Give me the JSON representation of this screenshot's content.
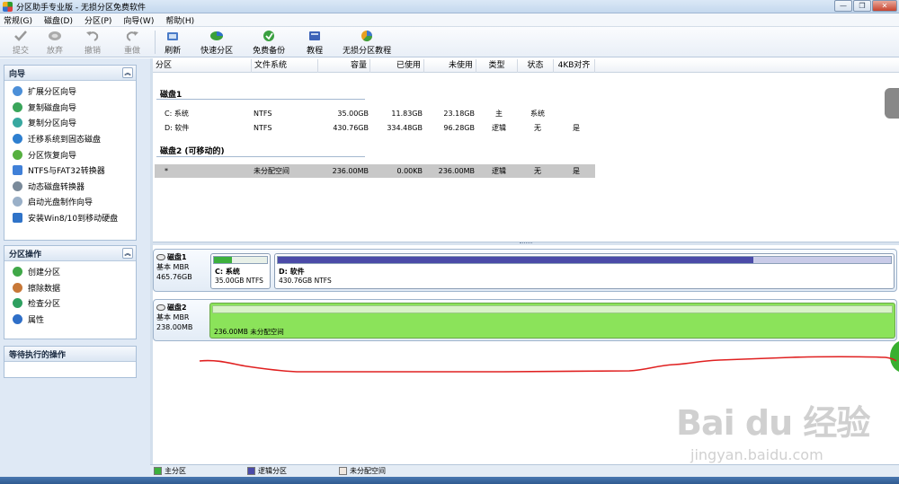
{
  "window": {
    "title": "分区助手专业版 - 无损分区免费软件",
    "controls": {
      "minimize": "—",
      "restore": "❐",
      "close": "✕"
    }
  },
  "menu": [
    "常规(G)",
    "磁盘(D)",
    "分区(P)",
    "向导(W)",
    "帮助(H)"
  ],
  "toolbar": {
    "commit": "提交",
    "discard": "放弃",
    "undo": "撤销",
    "redo": "重做",
    "refresh": "刷新",
    "quick_partition": "快速分区",
    "free_backup": "免费备份",
    "tutorial": "教程",
    "lossless_tutorial": "无损分区教程"
  },
  "sidebar": {
    "wizard": {
      "title": "向导",
      "items": [
        "扩展分区向导",
        "复制磁盘向导",
        "复制分区向导",
        "迁移系统到固态磁盘",
        "分区恢复向导",
        "NTFS与FAT32转换器",
        "动态磁盘转换器",
        "启动光盘制作向导",
        "安装Win8/10到移动硬盘"
      ]
    },
    "operations": {
      "title": "分区操作",
      "items": [
        "创建分区",
        "擦除数据",
        "检查分区",
        "属性"
      ]
    },
    "pending": {
      "title": "等待执行的操作"
    },
    "collapse_glyph": "︽"
  },
  "table": {
    "columns": [
      "分区",
      "文件系统",
      "容量",
      "已使用",
      "未使用",
      "类型",
      "状态",
      "4KB对齐"
    ],
    "groups": [
      {
        "name": "磁盘1",
        "rows": [
          {
            "partition": "C: 系统",
            "fs": "NTFS",
            "capacity": "35.00GB",
            "used": "11.83GB",
            "free": "23.18GB",
            "type": "主",
            "status": "系统",
            "align": ""
          },
          {
            "partition": "D: 软件",
            "fs": "NTFS",
            "capacity": "430.76GB",
            "used": "334.48GB",
            "free": "96.28GB",
            "type": "逻辑",
            "status": "无",
            "align": "是"
          }
        ]
      },
      {
        "name": "磁盘2 (可移动的)",
        "rows": [
          {
            "partition": "*",
            "fs": "未分配空间",
            "capacity": "236.00MB",
            "used": "0.00KB",
            "free": "236.00MB",
            "type": "逻辑",
            "status": "无",
            "align": "是"
          }
        ]
      }
    ]
  },
  "disk_map": {
    "disks": [
      {
        "name": "磁盘1",
        "kind": "基本 MBR",
        "size": "465.76GB",
        "partitions": [
          {
            "name": "C: 系统",
            "size": "35.00GB NTFS",
            "used_fraction": 0.338
          },
          {
            "name": "D: 软件",
            "size": "430.76GB NTFS",
            "used_fraction": 0.776
          }
        ]
      },
      {
        "name": "磁盘2",
        "kind": "基本 MBR",
        "size": "238.00MB",
        "partitions": [
          {
            "name": "",
            "size": "236.00MB 未分配空间",
            "used_fraction": 0
          }
        ]
      }
    ]
  },
  "legend": {
    "primary": "主分区",
    "logical": "逻辑分区",
    "unallocated": "未分配空间"
  },
  "watermark": {
    "main": "Bai du 经验",
    "sub": "jingyan.baidu.com"
  },
  "colors": {
    "primary_partition": "#3db03d",
    "logical_partition": "#4b4ba8",
    "unallocated": "#8be35a",
    "annotation_line": "#e02020"
  }
}
